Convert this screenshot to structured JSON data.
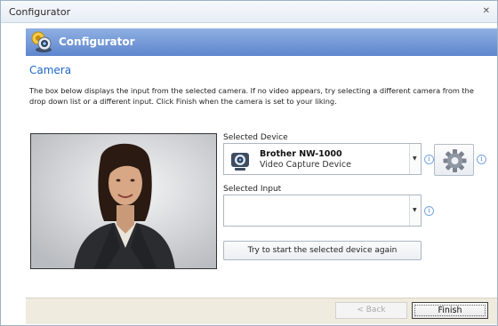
{
  "window": {
    "title": "Configurator",
    "close_glyph": "✕"
  },
  "banner": {
    "title": "Configurator",
    "icon": "webcam-icon"
  },
  "page": {
    "section_title": "Camera",
    "description": "The box below displays the input from the selected camera. If no video appears, try selecting a different camera from the drop down list or a different input.  Click Finish when the camera is set to your liking."
  },
  "device": {
    "label": "Selected Device",
    "name": "Brother NW-1000",
    "subtitle": "Video Capture Device",
    "icon": "webcam-icon"
  },
  "input": {
    "label": "Selected Input",
    "value": ""
  },
  "buttons": {
    "retry": "Try to start the selected device again",
    "back": "< Back",
    "finish": "Finish"
  },
  "glyphs": {
    "info": "i",
    "dropdown": "▼"
  },
  "colors": {
    "banner_top": "#8fb0e3",
    "banner_bottom": "#5f86cd",
    "section_title": "#1e66c8",
    "footer_bg": "#efebde"
  }
}
